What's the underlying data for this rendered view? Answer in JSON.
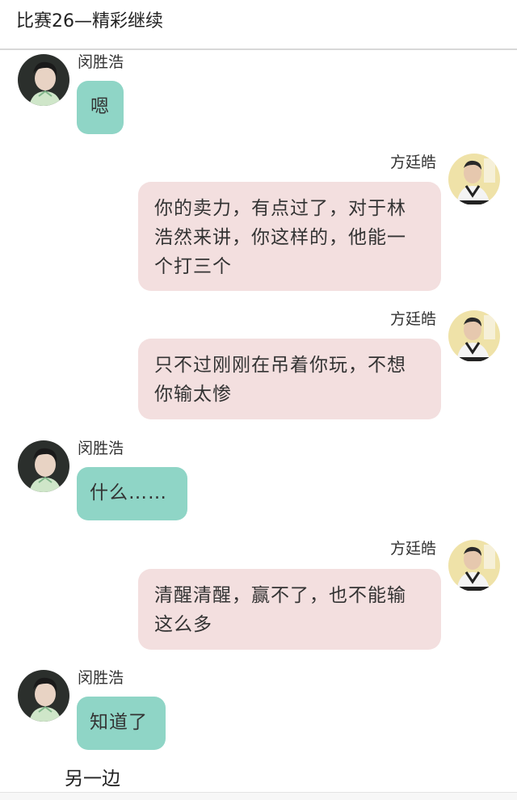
{
  "header": {
    "title": "比赛26—精彩继续"
  },
  "messages": [
    {
      "sender": "闵胜浩",
      "side": "left",
      "text": "嗯"
    },
    {
      "sender": "方廷皓",
      "side": "right",
      "text": "你的卖力，有点过了，对于林浩然来讲，你这样的，他能一个打三个"
    },
    {
      "sender": "方廷皓",
      "side": "right",
      "text": "只不过刚刚在吊着你玩，不想你输太惨"
    },
    {
      "sender": "闵胜浩",
      "side": "left",
      "text": "什么……"
    },
    {
      "sender": "方廷皓",
      "side": "right",
      "text": "清醒清醒，赢不了，也不能输这么多"
    },
    {
      "sender": "闵胜浩",
      "side": "left",
      "text": "知道了"
    }
  ],
  "footer_note": "另一边",
  "colors": {
    "left_bubble": "#8fd5c6",
    "right_bubble": "#f3dfdf",
    "background": "#ffffff",
    "divider": "#d8d8d8"
  }
}
